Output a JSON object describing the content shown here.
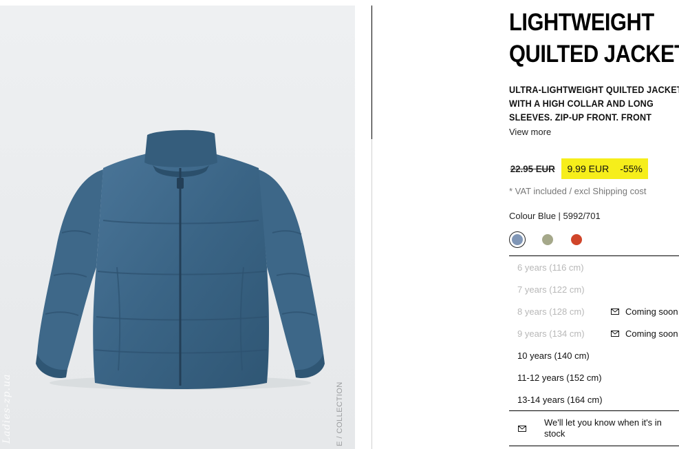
{
  "product": {
    "title_line1": "LIGHTWEIGHT",
    "title_line2": "QUILTED JACKET",
    "description_lines": [
      "ULTRA-LIGHTWEIGHT QUILTED JACKET",
      "WITH A HIGH COLLAR AND LONG",
      "SLEEVES. ZIP-UP FRONT. FRONT"
    ],
    "view_more": "View more"
  },
  "price": {
    "old": "22.95 EUR",
    "new": "9.99 EUR",
    "discount": "-55%",
    "highlight_color": "#f6ee1b",
    "vat_note": "* VAT included / excl Shipping cost"
  },
  "colour": {
    "label": "Colour Blue | 5992/701",
    "swatches": [
      {
        "name": "blue",
        "color": "#8096b6",
        "selected": true
      },
      {
        "name": "green",
        "color": "#a5a88a",
        "selected": false
      },
      {
        "name": "red",
        "color": "#d0452a",
        "selected": false
      }
    ]
  },
  "sizes": [
    {
      "label": "6 years (116 cm)",
      "available": false,
      "note": ""
    },
    {
      "label": "7 years (122 cm)",
      "available": false,
      "note": ""
    },
    {
      "label": "8 years (128 cm)",
      "available": false,
      "note": "Coming soon"
    },
    {
      "label": "9 years (134 cm)",
      "available": false,
      "note": "Coming soon"
    },
    {
      "label": "10 years (140 cm)",
      "available": true,
      "note": ""
    },
    {
      "label": "11-12 years (152 cm)",
      "available": true,
      "note": ""
    },
    {
      "label": "13-14 years (164 cm)",
      "available": true,
      "note": ""
    }
  ],
  "notify": {
    "text": "We'll let you know when it's in stock",
    "icon": "mail-icon"
  },
  "image": {
    "watermark": "Ladies-zp.ua",
    "collection_tag": "E / COLLECTION",
    "jacket_color": "#3a6485"
  }
}
